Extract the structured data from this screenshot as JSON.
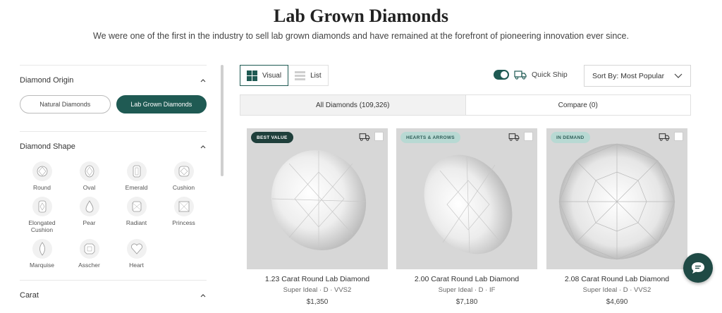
{
  "header": {
    "title": "Lab Grown Diamonds",
    "subtitle": "We were one of the first in the industry to sell lab grown diamonds and have remained at the forefront of pioneering innovation ever since."
  },
  "sidebar": {
    "origin": {
      "label": "Diamond Origin",
      "options": [
        {
          "label": "Natural Diamonds",
          "selected": false
        },
        {
          "label": "Lab Grown Diamonds",
          "selected": true
        }
      ]
    },
    "shape": {
      "label": "Diamond Shape",
      "items": [
        {
          "label": "Round",
          "icon": "round-diamond-icon"
        },
        {
          "label": "Oval",
          "icon": "oval-diamond-icon"
        },
        {
          "label": "Emerald",
          "icon": "emerald-diamond-icon"
        },
        {
          "label": "Cushion",
          "icon": "cushion-diamond-icon"
        },
        {
          "label": "Elongated Cushion",
          "icon": "elongated-cushion-diamond-icon"
        },
        {
          "label": "Pear",
          "icon": "pear-diamond-icon"
        },
        {
          "label": "Radiant",
          "icon": "radiant-diamond-icon"
        },
        {
          "label": "Princess",
          "icon": "princess-diamond-icon"
        },
        {
          "label": "Marquise",
          "icon": "marquise-diamond-icon"
        },
        {
          "label": "Asscher",
          "icon": "asscher-diamond-icon"
        },
        {
          "label": "Heart",
          "icon": "heart-diamond-icon"
        }
      ]
    },
    "carat": {
      "label": "Carat"
    }
  },
  "toolbar": {
    "view_visual": "Visual",
    "view_list": "List",
    "quick_ship": "Quick Ship",
    "quick_ship_on": true,
    "sort_label": "Sort By: Most Popular"
  },
  "tabs": {
    "all": "All Diamonds (109,326)",
    "compare": "Compare (0)"
  },
  "products": [
    {
      "badge": "BEST VALUE",
      "title": "1.23 Carat Round Lab Diamond",
      "specs": "Super Ideal · D · VVS2",
      "price": "$1,350"
    },
    {
      "badge": "HEARTS & ARROWS",
      "title": "2.00 Carat Round Lab Diamond",
      "specs": "Super Ideal · D · IF",
      "price": "$7,180"
    },
    {
      "badge": "IN DEMAND",
      "title": "2.08 Carat Round Lab Diamond",
      "specs": "Super Ideal · D · VVS2",
      "price": "$4,690"
    }
  ],
  "colors": {
    "brand": "#1f5a53",
    "badge_dark": "#1f3f3b",
    "badge_light": "#b8d9d3",
    "card_bg": "#d7d7d7"
  }
}
